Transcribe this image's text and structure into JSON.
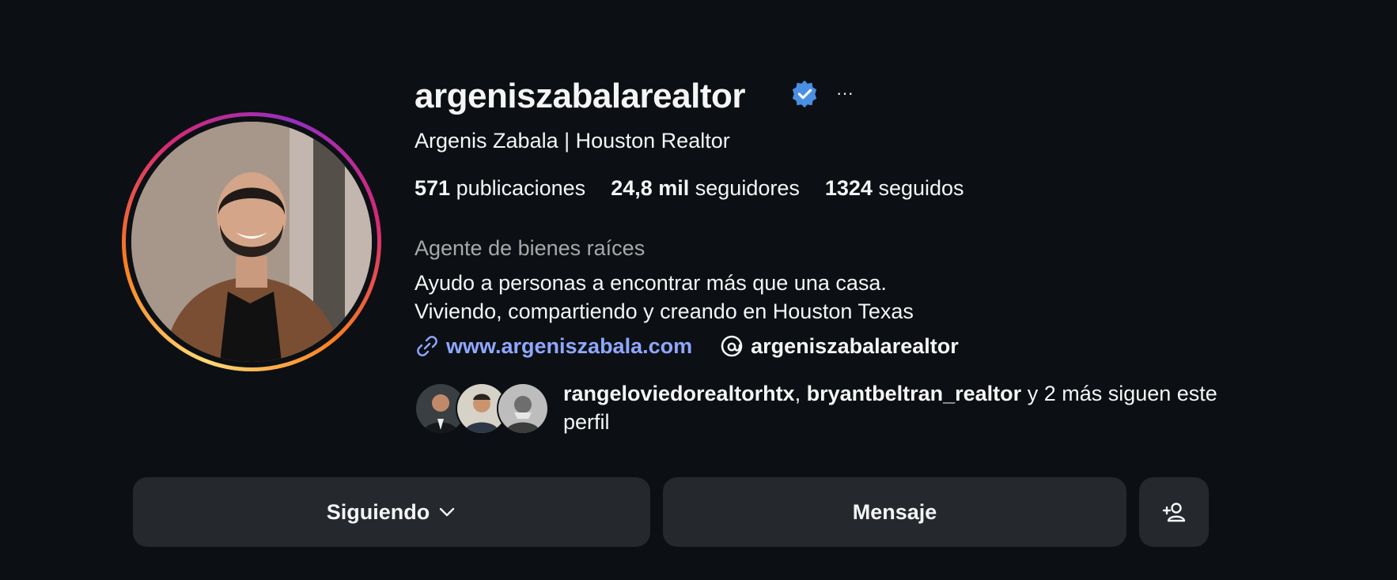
{
  "profile": {
    "username": "argeniszabalarealtor",
    "full_name": "Argenis Zabala | Houston Realtor",
    "verified_icon": "verified-badge-icon",
    "more_icon": "more-options-icon",
    "more_glyph": "···"
  },
  "stats": {
    "posts_value": "571",
    "posts_label": "publicaciones",
    "followers_value": "24,8 mil",
    "followers_label": "seguidores",
    "following_value": "1324",
    "following_label": "seguidos"
  },
  "bio": {
    "category": "Agente de bienes raíces",
    "line1": "Ayudo a personas a encontrar más que una casa.",
    "line2": "Viviendo, compartiendo y creando en Houston Texas"
  },
  "links": {
    "website": "www.argeniszabala.com",
    "threads_handle": "argeniszabalarealtor",
    "link_icon": "link-icon",
    "threads_icon": "threads-icon"
  },
  "mutual": {
    "user1": "rangeloviedorealtorhtx",
    "separator": ", ",
    "user2": "bryantbeltran_realtor",
    "suffix": " y 2 más siguen este perfil"
  },
  "actions": {
    "following_label": "Siguiendo",
    "message_label": "Mensaje",
    "add_icon": "add-person-icon"
  },
  "colors": {
    "background": "#0c1014",
    "button_bg": "#25292e",
    "link": "#8fa7ff",
    "verified": "#4a90e2",
    "secondary_text": "#a8a8a8"
  }
}
